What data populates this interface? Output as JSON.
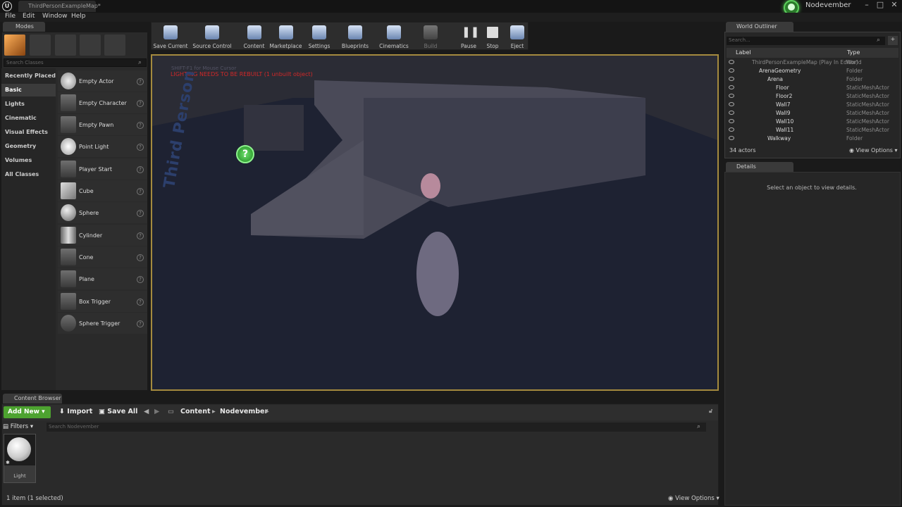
{
  "titlebar": {
    "document_tab": "ThirdPersonExampleMap*",
    "user_name": "Nodevember"
  },
  "menu": [
    "File",
    "Edit",
    "Window",
    "Help"
  ],
  "modes": {
    "tab_title": "Modes",
    "search_placeholder": "Search Classes",
    "categories": [
      "Recently Placed",
      "Basic",
      "Lights",
      "Cinematic",
      "Visual Effects",
      "Geometry",
      "Volumes",
      "All Classes"
    ],
    "selected_category": "Basic",
    "items": [
      "Empty Actor",
      "Empty Character",
      "Empty Pawn",
      "Point Light",
      "Player Start",
      "Cube",
      "Sphere",
      "Cylinder",
      "Cone",
      "Plane",
      "Box Trigger",
      "Sphere Trigger"
    ]
  },
  "toolbar": {
    "buttons": [
      "Save Current",
      "Source Control",
      "Content",
      "Marketplace",
      "Settings",
      "Blueprints",
      "Cinematics",
      "Build",
      "Pause",
      "Stop",
      "Eject"
    ]
  },
  "viewport": {
    "stat_text": "SHIFT-F1 for Mouse Cursor",
    "warning_text": "LIGHTING NEEDS TO BE REBUILT (1 unbuilt object)",
    "floor_text": "Third Person"
  },
  "outliner": {
    "tab_title": "World Outliner",
    "search_placeholder": "Search...",
    "col_label": "Label",
    "col_type": "Type",
    "rows": [
      {
        "label": "ThirdPersonExampleMap (Play In Editor)",
        "type": "World"
      },
      {
        "label": "ArenaGeometry",
        "type": "Folder"
      },
      {
        "label": "Arena",
        "type": "Folder"
      },
      {
        "label": "Floor",
        "type": "StaticMeshActor"
      },
      {
        "label": "Floor2",
        "type": "StaticMeshActor"
      },
      {
        "label": "Wall7",
        "type": "StaticMeshActor"
      },
      {
        "label": "Wall9",
        "type": "StaticMeshActor"
      },
      {
        "label": "Wall10",
        "type": "StaticMeshActor"
      },
      {
        "label": "Wall11",
        "type": "StaticMeshActor"
      },
      {
        "label": "Walkway",
        "type": "Folder"
      }
    ],
    "actor_count": "34 actors",
    "view_options": "View Options"
  },
  "details": {
    "tab_title": "Details",
    "empty_message": "Select an object to view details."
  },
  "content_browser": {
    "tab_title": "Content Browser",
    "add_new": "Add New",
    "import": "Import",
    "save_all": "Save All",
    "path": [
      "Content",
      "Nodevember"
    ],
    "filters": "Filters",
    "search_placeholder": "Search Nodevember",
    "asset_label": "Light",
    "status": "1 item (1 selected)",
    "view_options": "View Options"
  }
}
